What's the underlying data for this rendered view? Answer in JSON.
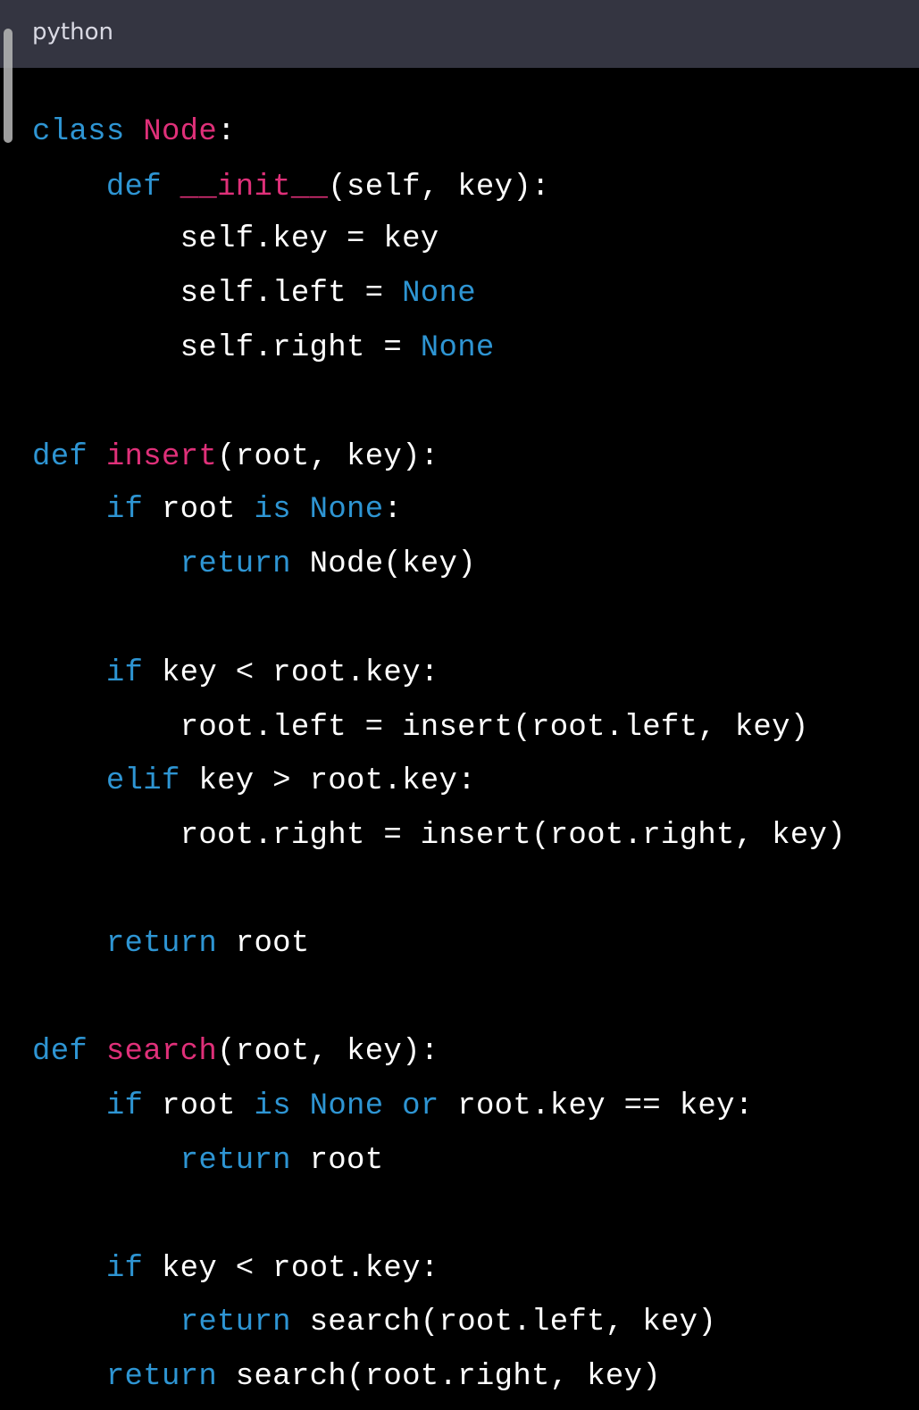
{
  "code_block": {
    "language_label": "python",
    "lines": [
      {
        "tokens": [
          {
            "t": "class ",
            "c": "kw"
          },
          {
            "t": "Node",
            "c": "cls"
          },
          {
            "t": ":",
            "c": "txt"
          }
        ]
      },
      {
        "tokens": [
          {
            "t": "    ",
            "c": "txt"
          },
          {
            "t": "def ",
            "c": "kw"
          },
          {
            "t": "__init__",
            "c": "fn"
          },
          {
            "t": "(self, key):",
            "c": "txt"
          }
        ]
      },
      {
        "tokens": [
          {
            "t": "        self.key = key",
            "c": "txt"
          }
        ]
      },
      {
        "tokens": [
          {
            "t": "        self.left = ",
            "c": "txt"
          },
          {
            "t": "None",
            "c": "const"
          }
        ]
      },
      {
        "tokens": [
          {
            "t": "        self.right = ",
            "c": "txt"
          },
          {
            "t": "None",
            "c": "const"
          }
        ]
      },
      {
        "tokens": []
      },
      {
        "tokens": [
          {
            "t": "def ",
            "c": "kw"
          },
          {
            "t": "insert",
            "c": "fn"
          },
          {
            "t": "(root, key):",
            "c": "txt"
          }
        ]
      },
      {
        "tokens": [
          {
            "t": "    ",
            "c": "txt"
          },
          {
            "t": "if ",
            "c": "kw"
          },
          {
            "t": "root ",
            "c": "txt"
          },
          {
            "t": "is ",
            "c": "kw"
          },
          {
            "t": "None",
            "c": "const"
          },
          {
            "t": ":",
            "c": "txt"
          }
        ]
      },
      {
        "tokens": [
          {
            "t": "        ",
            "c": "txt"
          },
          {
            "t": "return ",
            "c": "kw"
          },
          {
            "t": "Node(key)",
            "c": "txt"
          }
        ]
      },
      {
        "tokens": []
      },
      {
        "tokens": [
          {
            "t": "    ",
            "c": "txt"
          },
          {
            "t": "if ",
            "c": "kw"
          },
          {
            "t": "key < root.key:",
            "c": "txt"
          }
        ]
      },
      {
        "tokens": [
          {
            "t": "        root.left = insert(root.left, key)",
            "c": "txt"
          }
        ]
      },
      {
        "tokens": [
          {
            "t": "    ",
            "c": "txt"
          },
          {
            "t": "elif ",
            "c": "kw"
          },
          {
            "t": "key > root.key:",
            "c": "txt"
          }
        ]
      },
      {
        "tokens": [
          {
            "t": "        root.right = insert(root.right, key)",
            "c": "txt"
          }
        ]
      },
      {
        "tokens": []
      },
      {
        "tokens": [
          {
            "t": "    ",
            "c": "txt"
          },
          {
            "t": "return ",
            "c": "kw"
          },
          {
            "t": "root",
            "c": "txt"
          }
        ]
      },
      {
        "tokens": []
      },
      {
        "tokens": [
          {
            "t": "def ",
            "c": "kw"
          },
          {
            "t": "search",
            "c": "fn"
          },
          {
            "t": "(root, key):",
            "c": "txt"
          }
        ]
      },
      {
        "tokens": [
          {
            "t": "    ",
            "c": "txt"
          },
          {
            "t": "if ",
            "c": "kw"
          },
          {
            "t": "root ",
            "c": "txt"
          },
          {
            "t": "is ",
            "c": "kw"
          },
          {
            "t": "None ",
            "c": "const"
          },
          {
            "t": "or ",
            "c": "kw"
          },
          {
            "t": "root.key == key:",
            "c": "txt"
          }
        ]
      },
      {
        "tokens": [
          {
            "t": "        ",
            "c": "txt"
          },
          {
            "t": "return ",
            "c": "kw"
          },
          {
            "t": "root",
            "c": "txt"
          }
        ]
      },
      {
        "tokens": []
      },
      {
        "tokens": [
          {
            "t": "    ",
            "c": "txt"
          },
          {
            "t": "if ",
            "c": "kw"
          },
          {
            "t": "key < root.key:",
            "c": "txt"
          }
        ]
      },
      {
        "tokens": [
          {
            "t": "        ",
            "c": "txt"
          },
          {
            "t": "return ",
            "c": "kw"
          },
          {
            "t": "search(root.left, key)",
            "c": "txt"
          }
        ]
      },
      {
        "tokens": [
          {
            "t": "    ",
            "c": "txt"
          },
          {
            "t": "return ",
            "c": "kw"
          },
          {
            "t": "search(root.right, key)",
            "c": "txt"
          }
        ]
      }
    ]
  },
  "colors": {
    "background": "#000000",
    "header_background": "#343541",
    "keyword": "#2e95d3",
    "function_name": "#df3079",
    "text": "#ffffff"
  }
}
